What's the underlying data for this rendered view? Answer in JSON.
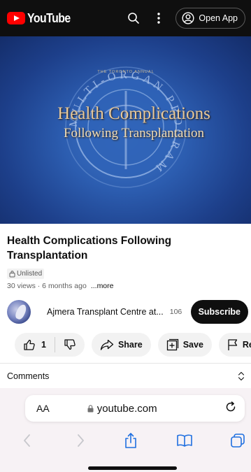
{
  "header": {
    "logo_text": "YouTube",
    "search_icon": "search-icon",
    "menu_icon": "more-vertical-icon",
    "open_app_label": "Open App"
  },
  "video": {
    "thumbnail_line1": "Health Complications",
    "thumbnail_line2": "Following Transplantation",
    "seal_top_text": "THE TORONTO ANNUAL",
    "seal_ring_text": "MULTI-ORGAN PROGRAM"
  },
  "details": {
    "title": "Health Complications Following Transplantation",
    "badge": "Unlisted",
    "meta": "30 views · 6 months ago",
    "more_label": "...more"
  },
  "channel": {
    "name": "Ajmera Transplant Centre at...",
    "subscribers": "106",
    "subscribe_label": "Subscribe"
  },
  "actions": {
    "like_count": "1",
    "share_label": "Share",
    "save_label": "Save",
    "report_label": "Re"
  },
  "comments": {
    "label": "Comments"
  },
  "browser": {
    "aa_label": "AA",
    "domain": "youtube.com"
  },
  "colors": {
    "brand_red": "#ff0000",
    "topbar_bg": "#0f0f0f",
    "pill_bg": "#f2f2f2",
    "safari_bg": "#f7f2f5"
  }
}
